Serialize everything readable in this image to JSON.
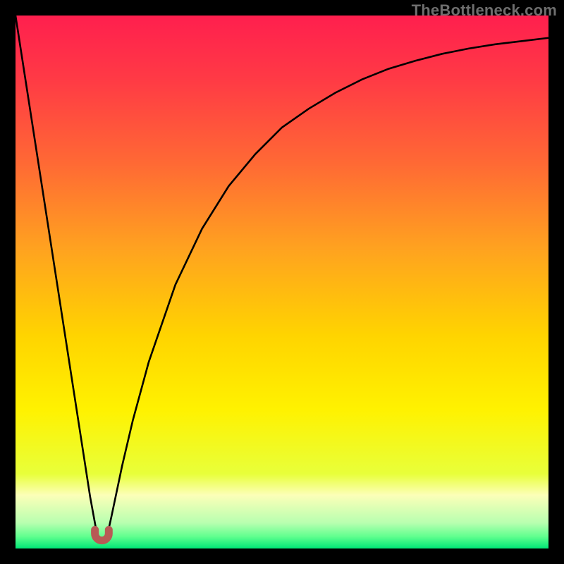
{
  "watermark": "TheBottleneck.com",
  "chart_data": {
    "type": "line",
    "title": "",
    "xlabel": "",
    "ylabel": "",
    "xlim": [
      0,
      1
    ],
    "ylim": [
      0,
      1
    ],
    "x": [
      0.0,
      0.02,
      0.04,
      0.06,
      0.08,
      0.1,
      0.12,
      0.14,
      0.155,
      0.17,
      0.18,
      0.2,
      0.22,
      0.25,
      0.3,
      0.35,
      0.4,
      0.45,
      0.5,
      0.55,
      0.6,
      0.65,
      0.7,
      0.75,
      0.8,
      0.85,
      0.9,
      0.95,
      1.0
    ],
    "values": [
      1.0,
      0.871,
      0.742,
      0.613,
      0.484,
      0.355,
      0.226,
      0.097,
      0.015,
      0.015,
      0.06,
      0.155,
      0.24,
      0.35,
      0.495,
      0.6,
      0.68,
      0.74,
      0.79,
      0.825,
      0.855,
      0.88,
      0.9,
      0.915,
      0.928,
      0.938,
      0.946,
      0.952,
      0.958
    ],
    "valley": {
      "x_center": 0.162,
      "y": 0.015,
      "half_width": 0.013,
      "arc_height": 0.02
    },
    "gradient_stops": [
      {
        "offset": 0.0,
        "color": "#ff1f4e"
      },
      {
        "offset": 0.12,
        "color": "#ff3a45"
      },
      {
        "offset": 0.28,
        "color": "#ff6a34"
      },
      {
        "offset": 0.44,
        "color": "#ffa31f"
      },
      {
        "offset": 0.6,
        "color": "#ffd400"
      },
      {
        "offset": 0.74,
        "color": "#fff200"
      },
      {
        "offset": 0.86,
        "color": "#e8ff3a"
      },
      {
        "offset": 0.9,
        "color": "#fcffb8"
      },
      {
        "offset": 0.952,
        "color": "#b8ffb0"
      },
      {
        "offset": 0.978,
        "color": "#5fff8e"
      },
      {
        "offset": 1.0,
        "color": "#00e676"
      }
    ],
    "curve_stroke": "#000000",
    "curve_width": 2.6,
    "valley_stroke": "#b85a55",
    "valley_width": 11
  }
}
